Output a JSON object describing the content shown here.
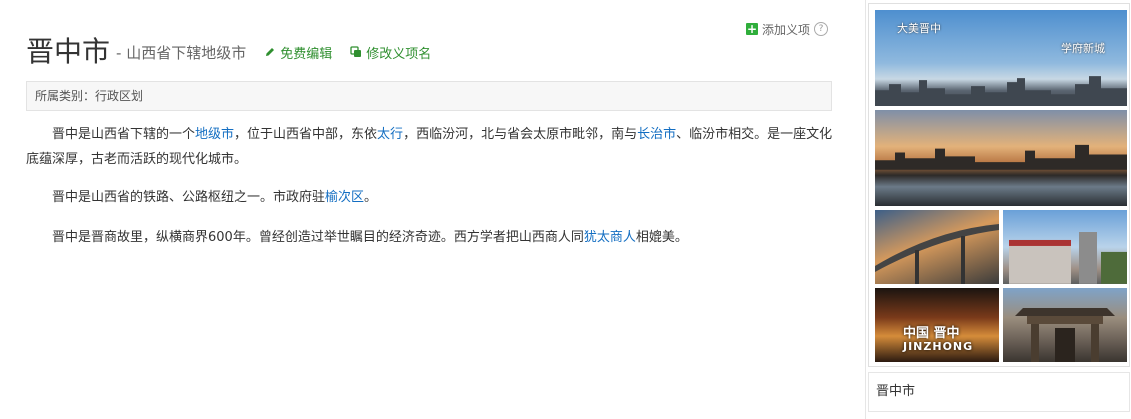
{
  "header": {
    "add_item_label": "添加义项",
    "help_icon": "?",
    "title": "晋中市",
    "subtitle": "- 山西省下辖地级市",
    "edit_label": "免费编辑",
    "rename_label": "修改义项名"
  },
  "category": {
    "text": "所属类别：行政区划"
  },
  "paragraphs": {
    "p1": {
      "t1": "晋中是山西省下辖的一个",
      "l1": "地级市",
      "t2": "，位于山西省中部，东依",
      "l2": "太行",
      "t3": "，西临汾河，北与省会太原市毗邻，南与",
      "l3": "长治市",
      "t4": "、临汾市相交。是一座文化底蕴深厚，古老而活跃的现代化城市。"
    },
    "p2": {
      "t1": "晋中是山西省的铁路、公路枢纽之一。市政府驻",
      "l1": "榆次区",
      "t2": "。"
    },
    "p3": {
      "t1": "晋中是晋商故里，纵横商界600年。曾经创造过举世瞩目的经济奇迹。西方学者把山西商人同",
      "l1": "犹太商人",
      "t2": "相媲美。"
    }
  },
  "album": {
    "photo1_caption_left": "大美晋中",
    "photo1_caption_right": "学府新城",
    "photo5_caption_cn": "中国 晋中",
    "photo5_caption_en": "JINZHONG",
    "title": "晋中市"
  },
  "colors": {
    "link": "#136ec2",
    "action_green": "#2f8f2f",
    "add_icon_green": "#2fae3b"
  }
}
